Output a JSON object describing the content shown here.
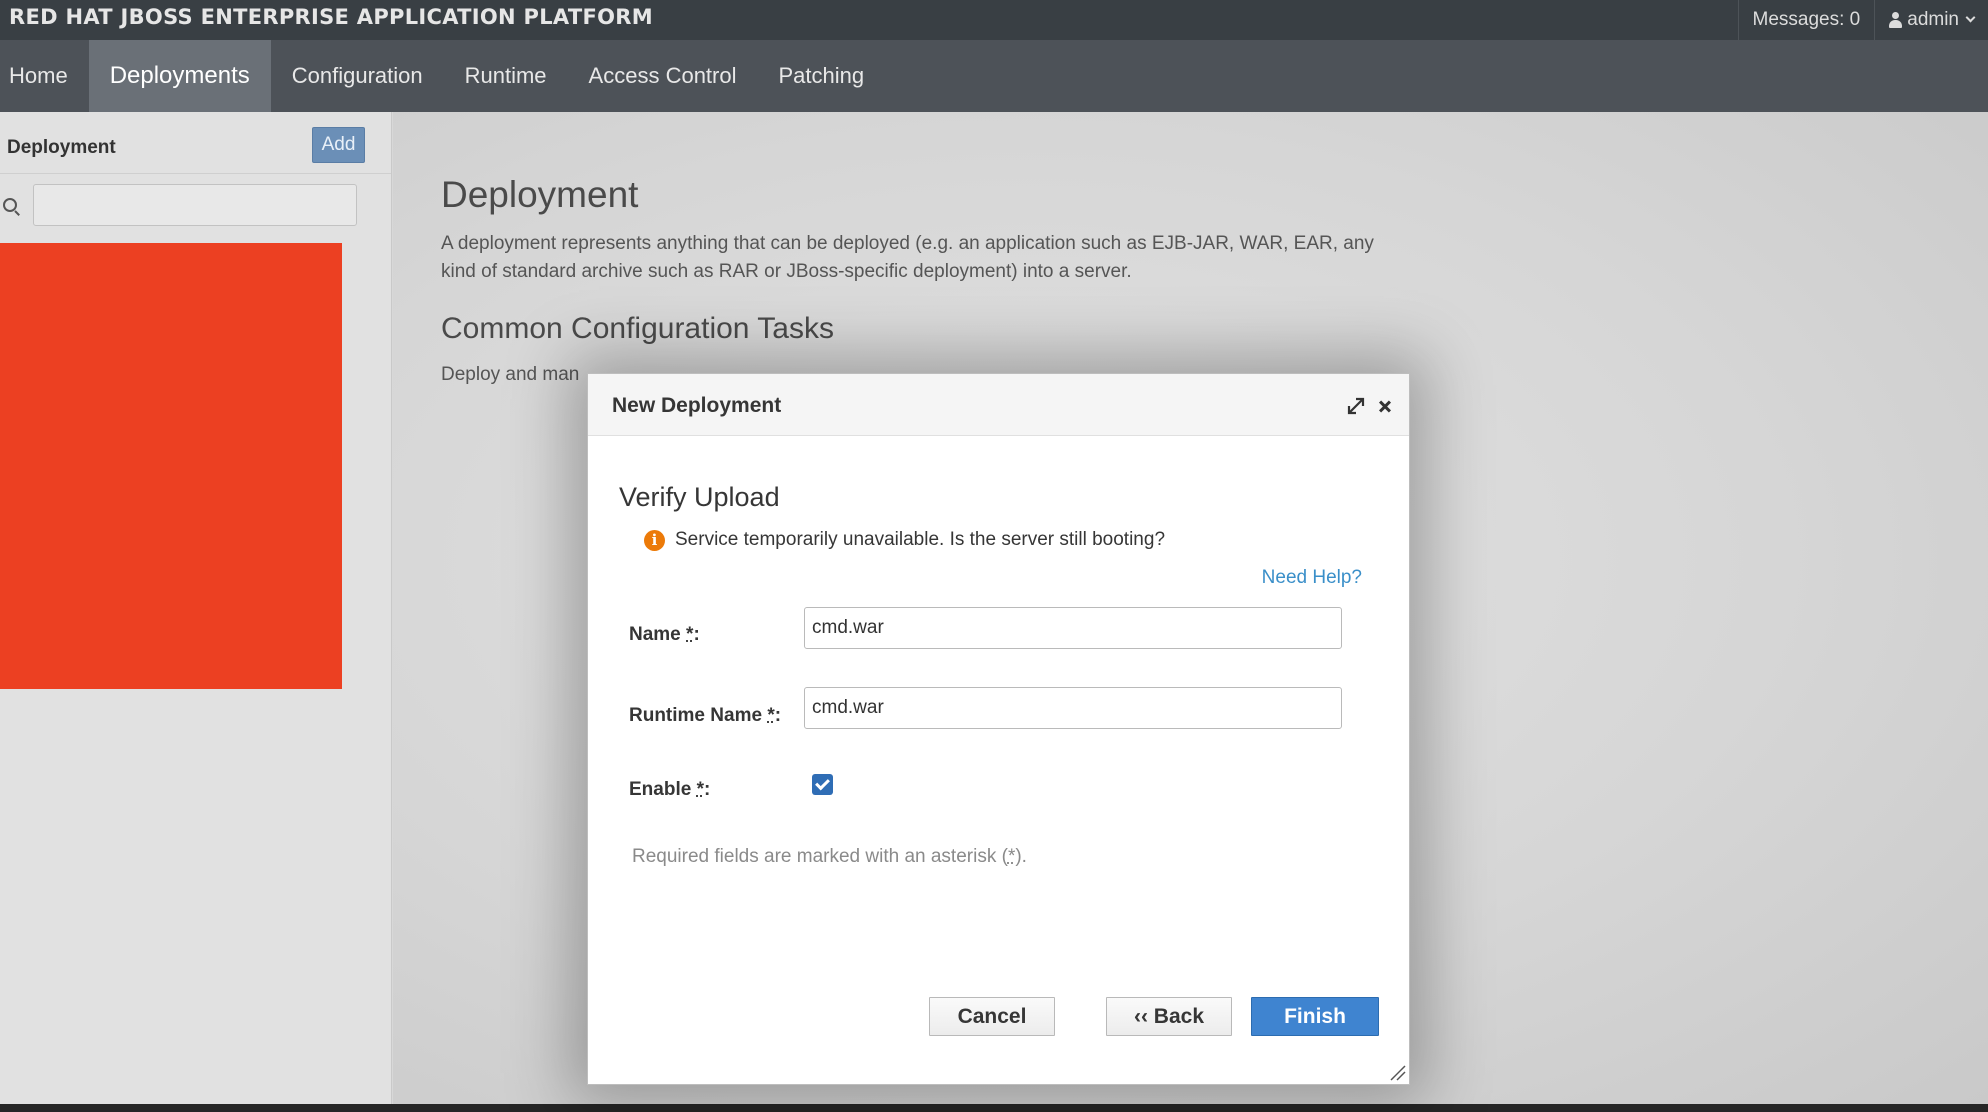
{
  "header": {
    "brand": "RED HAT JBOSS ENTERPRISE APPLICATION PLATFORM",
    "messages": "Messages: 0",
    "user": "admin"
  },
  "nav": {
    "items": [
      {
        "label": "Home"
      },
      {
        "label": "Deployments"
      },
      {
        "label": "Configuration"
      },
      {
        "label": "Runtime"
      },
      {
        "label": "Access Control"
      },
      {
        "label": "Patching"
      }
    ]
  },
  "sidebar": {
    "title": "Deployment",
    "add_label": "Add",
    "search_value": ""
  },
  "main": {
    "title": "Deployment",
    "description": "A deployment represents anything that can be deployed (e.g. an application such as EJB-JAR, WAR, EAR, any kind of standard archive such as RAR or JBoss-specific deployment) into a server.",
    "subtitle": "Common Configuration Tasks",
    "subtitle_desc": "Deploy and man"
  },
  "modal": {
    "title": "New Deployment",
    "step_title": "Verify Upload",
    "warning": "Service temporarily unavailable. Is the server still booting?",
    "help_link": "Need Help?",
    "fields": {
      "name_label": "Name",
      "name_value": "cmd.war",
      "runtime_label": "Runtime Name",
      "runtime_value": "cmd.war",
      "enable_label": "Enable",
      "enable_checked": true
    },
    "required_note": "Required fields are marked with an asterisk (",
    "required_note_end": ").",
    "buttons": {
      "cancel": "Cancel",
      "back": "‹‹ Back",
      "finish": "Finish"
    }
  },
  "colors": {
    "topbar": "#393f44",
    "navbar": "#4d5258",
    "nav_active": "#6a7077",
    "primary": "#3f84d0",
    "link": "#3a8fc9",
    "warning": "#ec7a08",
    "red_block": "#ec4022"
  }
}
